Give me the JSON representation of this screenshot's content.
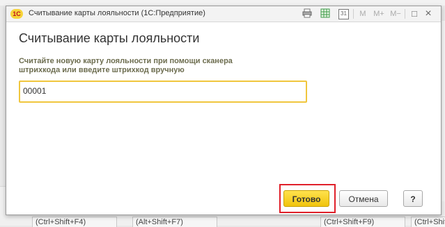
{
  "window": {
    "app_logo": "1С",
    "title": "Считывание карты лояльности",
    "app_name": "(1С:Предприятие)",
    "toolbar_icons": [
      "print-icon",
      "spreadsheet-icon",
      "calendar-icon"
    ],
    "calendar_number": "31",
    "memory_buttons": [
      "M",
      "M+",
      "M−"
    ],
    "window_controls": {
      "restore": "□",
      "close": "×"
    }
  },
  "form": {
    "title": "Считывание карты лояльности",
    "instruction": "Считайте новую карту лояльности при помощи сканера штрихкода или введите штрихкод вручную",
    "barcode_value": "00001"
  },
  "buttons": {
    "ok": "Готово",
    "cancel": "Отмена",
    "help": "?"
  },
  "background": {
    "shortcuts": [
      "(Ctrl+Shift+F4)",
      "(Alt+Shift+F7)",
      "(Ctrl+Shift+F9)",
      "(Ctrl+Shift"
    ]
  },
  "colors": {
    "accent_yellow": "#f1c40c",
    "highlight_red": "#e0202a",
    "input_border": "#f0c63d"
  }
}
